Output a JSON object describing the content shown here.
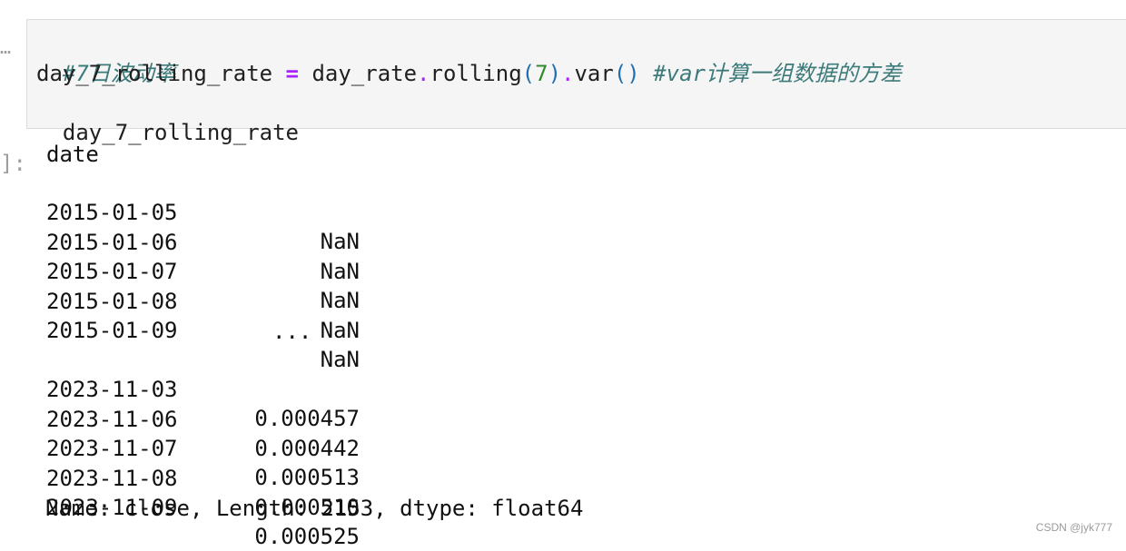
{
  "notebook": {
    "input_prompt": "…",
    "output_prompt": "]:",
    "code": {
      "line1_comment": "#7日波动率",
      "line2_lhs": "day_7_rolling_rate",
      "line2_eq": " = ",
      "line2_obj": "day_rate",
      "line2_dot1": ".",
      "line2_rolling": "rolling",
      "line2_paren_open": "(",
      "line2_arg": "7",
      "line2_paren_close": ")",
      "line2_dot2": ".",
      "line2_var": "var",
      "line2_call": "()",
      "line2_space": " ",
      "line2_comment": "#var计算一组数据的方差",
      "line3": "day_7_rolling_rate"
    },
    "output": {
      "index_name": "date",
      "rows": [
        {
          "date": "2015-01-05",
          "value": "NaN"
        },
        {
          "date": "2015-01-06",
          "value": "NaN"
        },
        {
          "date": "2015-01-07",
          "value": "NaN"
        },
        {
          "date": "2015-01-08",
          "value": "NaN"
        },
        {
          "date": "2015-01-09",
          "value": "NaN"
        }
      ],
      "ellipsis": "...",
      "rows_tail": [
        {
          "date": "2023-11-03",
          "value": "0.000457"
        },
        {
          "date": "2023-11-06",
          "value": "0.000442"
        },
        {
          "date": "2023-11-07",
          "value": "0.000513"
        },
        {
          "date": "2023-11-08",
          "value": "0.000510"
        },
        {
          "date": "2023-11-09",
          "value": "0.000525"
        }
      ],
      "footer": "Name: close, Length: 2153, dtype: float64"
    }
  },
  "watermark": "CSDN @jyk777"
}
